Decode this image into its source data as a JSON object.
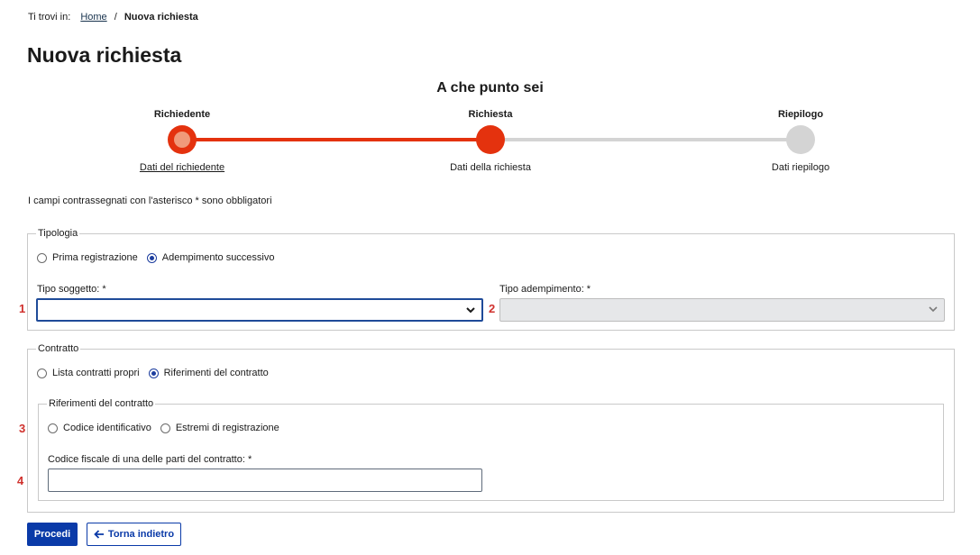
{
  "breadcrumb": {
    "prefix": "Ti trovi in:",
    "home": "Home",
    "separator": "/",
    "current": "Nuova richiesta"
  },
  "page_title": "Nuova richiesta",
  "stepper": {
    "title": "A che punto sei",
    "steps": [
      {
        "label": "Richiedente",
        "sub": "Dati del richiedente",
        "state": "done"
      },
      {
        "label": "Richiesta",
        "sub": "Dati della richiesta",
        "state": "current"
      },
      {
        "label": "Riepilogo",
        "sub": "Dati riepilogo",
        "state": "todo"
      }
    ]
  },
  "required_note": "I campi contrassegnati con l'asterisco * sono obbligatori",
  "tipologia": {
    "legend": "Tipologia",
    "options": [
      "Prima registrazione",
      "Adempimento successivo"
    ],
    "selected": "Adempimento successivo",
    "tipo_soggetto": {
      "label": "Tipo soggetto: *",
      "value": ""
    },
    "tipo_adempimento": {
      "label": "Tipo adempimento: *",
      "value": "",
      "disabled": true
    }
  },
  "contratto": {
    "legend": "Contratto",
    "options": [
      "Lista contratti propri",
      "Riferimenti del contratto"
    ],
    "selected": "Riferimenti del contratto",
    "riferimenti": {
      "legend": "Riferimenti del contratto",
      "options": [
        "Codice identificativo",
        "Estremi di registrazione"
      ],
      "selected": "",
      "codice_fiscale": {
        "label": "Codice fiscale di una delle parti del contratto: *",
        "value": ""
      }
    }
  },
  "markers": [
    "1",
    "2",
    "3",
    "4"
  ],
  "buttons": {
    "proceed": "Procedi",
    "back": "Torna indietro"
  },
  "colors": {
    "accent": "#e4320e",
    "primary": "#0a3aa8",
    "marker": "#d0312d",
    "inactive": "#d4d4d4"
  },
  "icons": {
    "select_arrow": "chevron-down-icon",
    "back": "arrow-left-icon"
  }
}
